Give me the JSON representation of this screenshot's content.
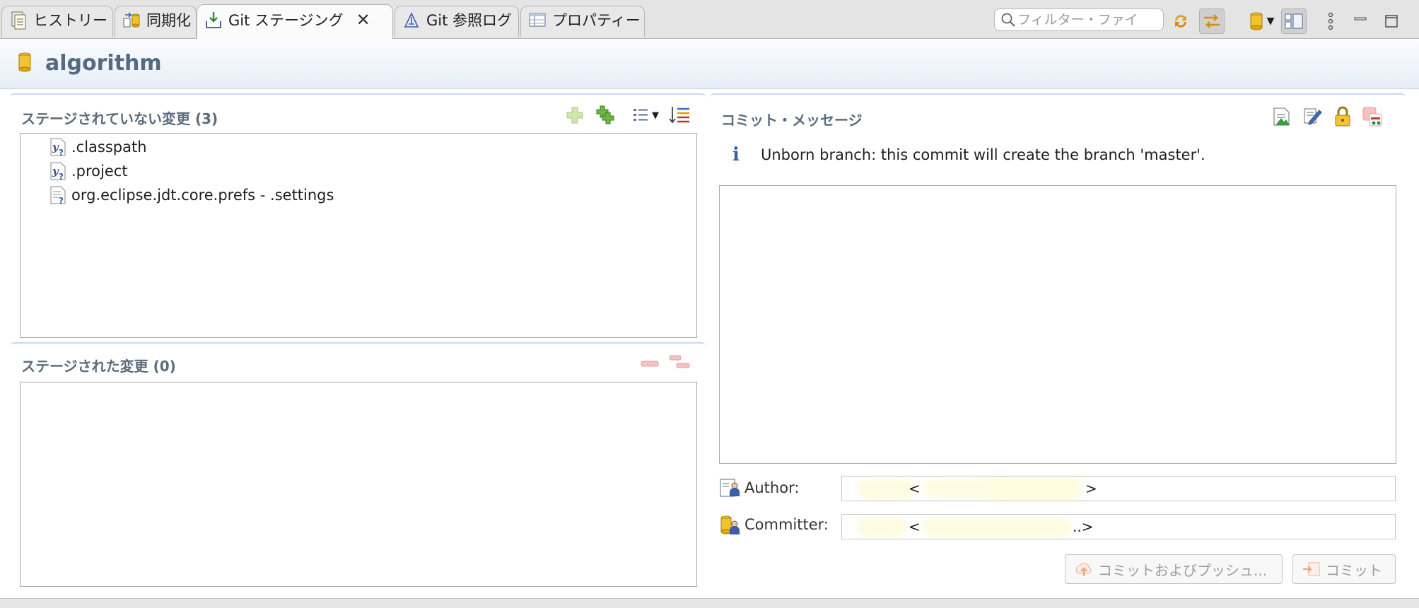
{
  "tabs": [
    {
      "label": "ヒストリー",
      "icon": "history-icon"
    },
    {
      "label": "同期化",
      "icon": "synchronize-icon"
    },
    {
      "label": "Git ステージング",
      "icon": "git-staging-icon",
      "active": true
    },
    {
      "label": "Git 参照ログ",
      "icon": "git-reflog-icon"
    },
    {
      "label": "プロパティー",
      "icon": "properties-icon"
    }
  ],
  "toolbar": {
    "filter_placeholder": "フィルター・ファイ"
  },
  "repository": {
    "name": "algorithm"
  },
  "unstaged": {
    "title": "ステージされていない変更 (3)",
    "files": [
      {
        "name": ".classpath",
        "icon": "untracked-file-icon"
      },
      {
        "name": ".project",
        "icon": "untracked-file-icon"
      },
      {
        "name": "org.eclipse.jdt.core.prefs - .settings",
        "icon": "untracked-file-icon"
      }
    ]
  },
  "staged": {
    "title": "ステージされた変更 (0)"
  },
  "commit": {
    "title": "コミット・メッセージ",
    "info": "Unborn branch: this commit will create the branch 'master'.",
    "message": "",
    "author_label": "Author:",
    "author_value_lt": "<",
    "author_value_gt": ">",
    "committer_label": "Committer:",
    "committer_value_lt": "<",
    "committer_value_gt": "..>",
    "commit_push_label": "コミットおよびプッシュ...",
    "commit_label": "コミット"
  },
  "colors": {
    "accent_header_text": "#546a82",
    "section_title": "#5b6b7c",
    "disabled_text": "#9c9c9c",
    "info_icon": "#3a5fa8"
  }
}
